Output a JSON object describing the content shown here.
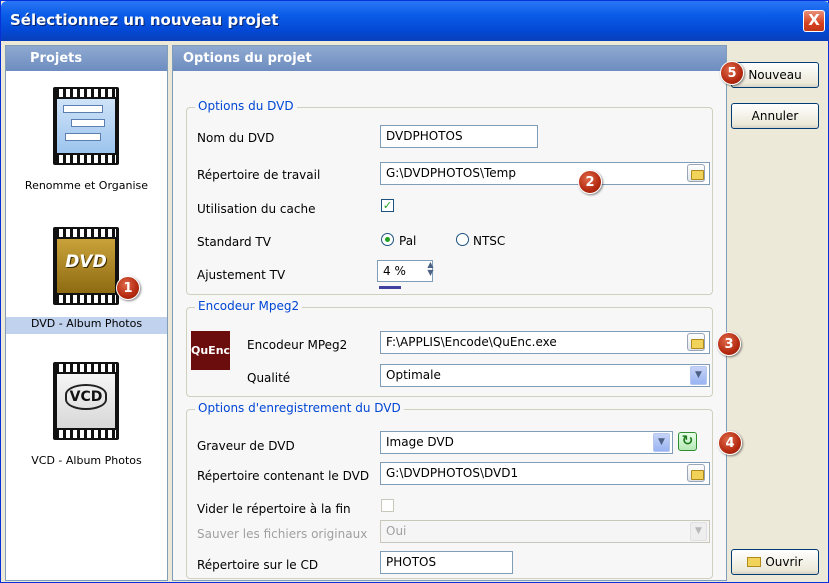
{
  "window": {
    "title": "Sélectionnez un nouveau projet",
    "close_label": "X"
  },
  "left_panel": {
    "header": "Projets",
    "items": [
      {
        "label": "Renomme et Organise",
        "icon": "film-folder-icon"
      },
      {
        "label": "DVD - Album Photos",
        "icon": "dvd-video-icon",
        "selected": true,
        "badge": "1"
      },
      {
        "label": "VCD - Album Photos",
        "icon": "vcd-icon"
      }
    ]
  },
  "center_panel": {
    "header": "Options du projet",
    "dvd_options": {
      "legend": "Options du DVD",
      "nom_label": "Nom du DVD",
      "nom_value": "DVDPHOTOS",
      "repertoire_label": "Répertoire de travail",
      "repertoire_value": "G:\\DVDPHOTOS\\Temp",
      "repertoire_badge": "2",
      "cache_label": "Utilisation du cache",
      "cache_checked": true,
      "standard_label": "Standard TV",
      "standard_options": [
        "Pal",
        "NTSC"
      ],
      "standard_selected": "Pal",
      "ajustement_label": "Ajustement TV",
      "ajustement_value": "4 %"
    },
    "encoder": {
      "legend": "Encodeur Mpeg2",
      "logo_text": "QuEnc",
      "encodeur_label": "Encodeur MPeg2",
      "encodeur_value": "F:\\APPLIS\\Encode\\QuEnc.exe",
      "encodeur_badge": "3",
      "qualite_label": "Qualité",
      "qualite_value": "Optimale"
    },
    "recording": {
      "legend": "Options d'enregistrement du DVD",
      "graveur_label": "Graveur de DVD",
      "graveur_value": "Image DVD",
      "graveur_badge": "4",
      "rep_dvd_label": "Répertoire contenant le DVD",
      "rep_dvd_value": "G:\\DVDPHOTOS\\DVD1",
      "vider_label": "Vider le répertoire à la fin",
      "sauver_label": "Sauver les fichiers originaux",
      "sauver_value": "Oui",
      "rep_cd_label": "Répertoire sur le CD",
      "rep_cd_value": "PHOTOS"
    }
  },
  "right_panel": {
    "nouveau_label": "Nouveau",
    "nouveau_badge": "5",
    "annuler_label": "Annuler",
    "ouvrir_label": "Ouvrir"
  }
}
